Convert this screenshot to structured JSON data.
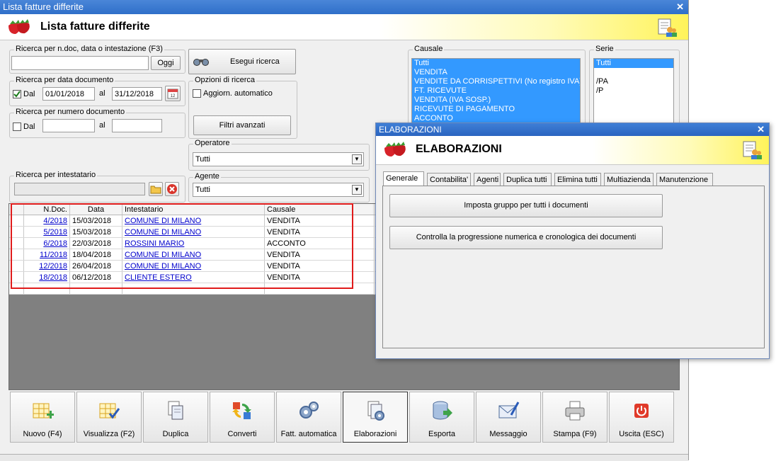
{
  "main": {
    "title": "Lista fatture differite",
    "header": "Lista fatture differite",
    "search_text": {
      "legend": "Ricerca per n.doc, data o intestazione (F3)",
      "value": "",
      "btn": "Oggi"
    },
    "run_search": "Esegui ricerca",
    "by_date": {
      "legend": "Ricerca per data documento",
      "dal": "Dal",
      "from": "01/01/2018",
      "al": "al",
      "to": "31/12/2018",
      "checked": true
    },
    "by_number": {
      "legend": "Ricerca per numero documento",
      "dal": "Dal",
      "al": "al",
      "from": "",
      "to": ""
    },
    "options": {
      "legend": "Opzioni di ricerca",
      "auto_update": "Aggiorn. automatico",
      "advanced": "Filtri avanzati"
    },
    "causale": {
      "legend": "Causale",
      "items": [
        "Tutti",
        "VENDITA",
        "VENDITE DA CORRISPETTIVI (No registro IVA)",
        "FT. RICEVUTE",
        "VENDITA (IVA SOSP.)",
        "RICEVUTE DI PAGAMENTO",
        "ACCONTO"
      ]
    },
    "serie": {
      "legend": "Serie",
      "items": [
        "Tutti",
        "",
        "/PA",
        "/P"
      ]
    },
    "operatore": {
      "legend": "Operatore",
      "value": "Tutti"
    },
    "agente": {
      "legend": "Agente",
      "value": "Tutti"
    },
    "intestatario": {
      "legend": "Ricerca per intestatario",
      "value": ""
    },
    "grid": {
      "headers": [
        "N.Doc.",
        "Data",
        "Intestatario",
        "Causale"
      ],
      "rows": [
        [
          "4/2018",
          "15/03/2018",
          "COMUNE DI MILANO",
          "VENDITA"
        ],
        [
          "5/2018",
          "15/03/2018",
          "COMUNE DI MILANO",
          "VENDITA"
        ],
        [
          "6/2018",
          "22/03/2018",
          "ROSSINI MARIO",
          "ACCONTO"
        ],
        [
          "11/2018",
          "18/04/2018",
          "COMUNE DI MILANO",
          "VENDITA"
        ],
        [
          "12/2018",
          "26/04/2018",
          "COMUNE DI MILANO",
          "VENDITA"
        ],
        [
          "18/2018",
          "06/12/2018",
          "CLIENTE ESTERO",
          "VENDITA"
        ]
      ]
    },
    "toolbar": [
      "Nuovo (F4)",
      "Visualizza (F2)",
      "Duplica",
      "Converti",
      "Fatt. automatica",
      "Elaborazioni",
      "Esporta",
      "Messaggio",
      "Stampa (F9)",
      "Uscita (ESC)"
    ]
  },
  "dialog": {
    "title": "ELABORAZIONI",
    "header": "ELABORAZIONI",
    "tabs": [
      "Generale",
      "Contabilita'",
      "Agenti",
      "Duplica tutti",
      "Elimina tutti",
      "Multiazienda",
      "Manutenzione"
    ],
    "active_tab": "Generale",
    "buttons": [
      "Imposta gruppo per tutti i documenti",
      "Controlla la progressione numerica e cronologica dei documenti"
    ]
  },
  "colors": {
    "titlebar": "#2f6fc9",
    "selection": "#3399ff",
    "link": "#0000cc",
    "highlight_box": "#e01b1b"
  }
}
